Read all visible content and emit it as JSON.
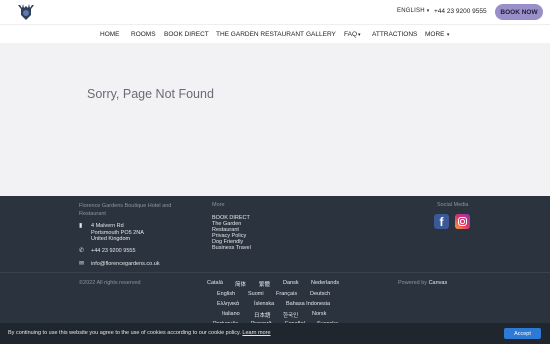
{
  "header": {
    "logo_icon": "stag-crest-icon",
    "language": "ENGLISH",
    "phone": "+44 23 9200 9555",
    "book_now": "BOOK NOW",
    "accent": "#9b8fc9"
  },
  "nav": {
    "items": [
      {
        "label": "HOME",
        "dropdown": false
      },
      {
        "label": "ROOMS",
        "dropdown": false
      },
      {
        "label": "BOOK DIRECT",
        "dropdown": false
      },
      {
        "label": "THE GARDEN RESTAURANT",
        "dropdown": false
      },
      {
        "label": "GALLERY",
        "dropdown": false
      },
      {
        "label": "FAQ",
        "dropdown": true
      },
      {
        "label": "ATTRACTIONS",
        "dropdown": false
      },
      {
        "label": "MORE",
        "dropdown": true
      }
    ]
  },
  "main": {
    "message": "Sorry, Page Not Found"
  },
  "footer": {
    "hotel_name": "Florence Gardens Boutique Hotel and Restaurant",
    "address_lines": [
      "4 Malvern Rd",
      "Portsmouth PO5 2NA",
      "United Kingdom"
    ],
    "phone": "+44 23 9200 9555",
    "email": "info@florencegardens.co.uk",
    "more_title": "More",
    "more_links": [
      "BOOK DIRECT",
      "The Garden",
      "Restaurant",
      "Privacy Policy",
      "Dog Friendly",
      "Business Travel"
    ],
    "social_title": "Social Media",
    "copyright": "©2022 All rights reserved",
    "powered_prefix": "Powered by",
    "powered_brand": "Canvas",
    "languages": [
      [
        "Català",
        "简体",
        "繁體",
        "Dansk",
        "Nederlands"
      ],
      [
        "English",
        "Suomi",
        "Français",
        "Deutsch"
      ],
      [
        "Ελληνικά",
        "Íslenska",
        "Bahasa Indonesia"
      ],
      [
        "Italiano",
        "日本語",
        "한국인",
        "Norsk"
      ],
      [
        "Português",
        "Русский",
        "Español",
        "Svenska"
      ]
    ]
  },
  "cookie": {
    "text": "By continuing to use this website you agree to the use of cookies according to our cookie policy.",
    "link": "Learn more",
    "accept": "Accept"
  }
}
